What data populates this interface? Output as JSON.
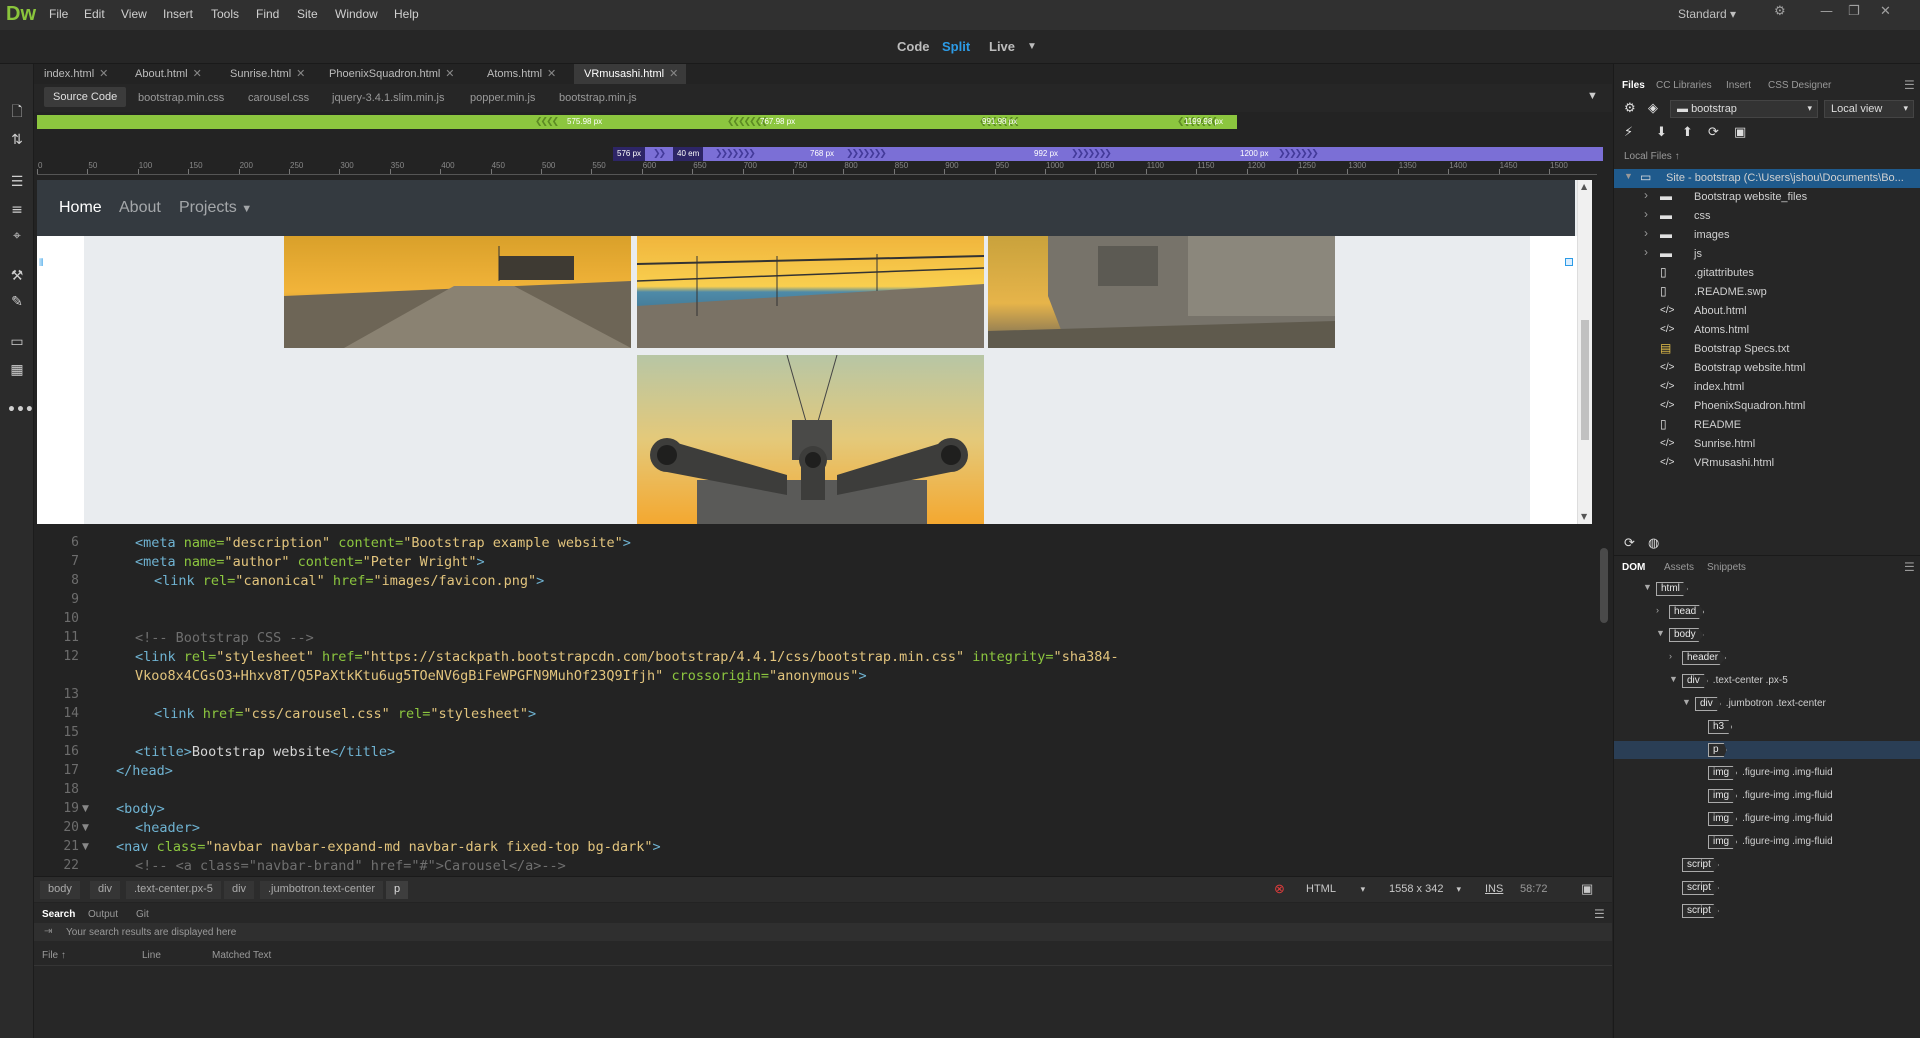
{
  "app": {
    "logo": "Dw",
    "menu": [
      "File",
      "Edit",
      "View",
      "Insert",
      "Tools",
      "Find",
      "Site",
      "Window",
      "Help"
    ],
    "workspace": "Standard"
  },
  "view_switch": {
    "code": "Code",
    "split": "Split",
    "live": "Live"
  },
  "doc_tabs": [
    "index.html",
    "About.html",
    "Sunrise.html",
    "PhoenixSquadron.html",
    "Atoms.html",
    "VRmusashi.html"
  ],
  "related_files": [
    "Source Code",
    "bootstrap.min.css",
    "carousel.css",
    "jquery-3.4.1.slim.min.js",
    "popper.min.js",
    "bootstrap.min.js"
  ],
  "media_queries": {
    "green": [
      "575.98 px",
      "767.98 px",
      "991.98 px",
      "1199.98 px"
    ],
    "purple": [
      "576 px",
      "40 em",
      "768 px",
      "992 px",
      "1200 px"
    ]
  },
  "ruler_ticks": [
    "0",
    "50",
    "100",
    "150",
    "200",
    "250",
    "300",
    "350",
    "400",
    "450",
    "500",
    "550",
    "600",
    "650",
    "700",
    "750",
    "800",
    "850",
    "900",
    "950",
    "1000",
    "1050",
    "1100",
    "1150",
    "1200",
    "1250",
    "1300",
    "1350",
    "1400",
    "1450",
    "1500"
  ],
  "live_view": {
    "nav": {
      "home": "Home",
      "about": "About",
      "projects": "Projects"
    }
  },
  "code_lines": [
    {
      "n": "6"
    },
    {
      "n": "7"
    },
    {
      "n": "8"
    },
    {
      "n": "9"
    },
    {
      "n": "10"
    },
    {
      "n": "11"
    },
    {
      "n": "12"
    },
    {
      "n": "13"
    },
    {
      "n": "14"
    },
    {
      "n": "15"
    },
    {
      "n": "16"
    },
    {
      "n": "17"
    },
    {
      "n": "18"
    },
    {
      "n": "19"
    },
    {
      "n": "20"
    },
    {
      "n": "21"
    },
    {
      "n": "22"
    }
  ],
  "code": {
    "l6_a": "description",
    "l6_b": "Bootstrap example website",
    "l7_a": "author",
    "l7_b": "Peter Wright",
    "l8_a": "canonical",
    "l8_b": "images/favicon.png",
    "l11": "<!-- Bootstrap CSS -->",
    "l12_a": "stylesheet",
    "l12_b": "https://stackpath.bootstrapcdn.com/bootstrap/4.4.1/css/bootstrap.min.css",
    "l12_c": "sha384-",
    "l12_d": "Vkoo8x4CGsO3+Hhxv8T/Q5PaXtkKtu6ug5TOeNV6gBiFeWPGFN9MuhOf23Q9Ifjh",
    "l12_e": "anonymous",
    "l14_a": "css/carousel.css",
    "l14_b": "stylesheet",
    "l16": "Bootstrap website",
    "l21": "navbar navbar-expand-md navbar-dark fixed-top bg-dark",
    "l22": "<!-- <a class=\"navbar-brand\" href=\"#\">Carousel</a>-->"
  },
  "status": {
    "breadcrumbs": [
      "body",
      "div",
      ".text-center.px-5",
      "div",
      ".jumbotron.text-center",
      "p"
    ],
    "language": "HTML",
    "size": "1558 x 342",
    "mode": "INS",
    "position": "58:72"
  },
  "search_panel": {
    "tabs": [
      "Search",
      "Output",
      "Git"
    ],
    "message": "Your search results are displayed here",
    "columns": [
      "File",
      "Line",
      "Matched Text"
    ]
  },
  "files_panel": {
    "tabs": [
      "Files",
      "CC Libraries",
      "Insert",
      "CSS Designer"
    ],
    "site": "bootstrap",
    "view": "Local view",
    "local_files_label": "Local Files",
    "site_root": "Site - bootstrap (C:\\Users\\jshou\\Documents\\Bo...",
    "items": [
      {
        "name": "Bootstrap website_files",
        "type": "folder"
      },
      {
        "name": "css",
        "type": "folder"
      },
      {
        "name": "images",
        "type": "folder"
      },
      {
        "name": "js",
        "type": "folder"
      },
      {
        "name": ".gitattributes",
        "type": "file"
      },
      {
        "name": ".README.swp",
        "type": "file"
      },
      {
        "name": "About.html",
        "type": "code"
      },
      {
        "name": "Atoms.html",
        "type": "code"
      },
      {
        "name": "Bootstrap Specs.txt",
        "type": "text"
      },
      {
        "name": "Bootstrap website.html",
        "type": "code"
      },
      {
        "name": "index.html",
        "type": "code"
      },
      {
        "name": "PhoenixSquadron.html",
        "type": "code"
      },
      {
        "name": "README",
        "type": "file"
      },
      {
        "name": "Sunrise.html",
        "type": "code"
      },
      {
        "name": "VRmusashi.html",
        "type": "code"
      }
    ]
  },
  "dom_panel": {
    "tabs": [
      "DOM",
      "Assets",
      "Snippets"
    ],
    "nodes": [
      {
        "tag": "html",
        "cls": ""
      },
      {
        "tag": "head",
        "cls": ""
      },
      {
        "tag": "body",
        "cls": ""
      },
      {
        "tag": "header",
        "cls": ""
      },
      {
        "tag": "div",
        "cls": ".text-center .px-5"
      },
      {
        "tag": "div",
        "cls": ".jumbotron .text-center"
      },
      {
        "tag": "h3",
        "cls": ""
      },
      {
        "tag": "p",
        "cls": ""
      },
      {
        "tag": "img",
        "cls": ".figure-img .img-fluid"
      },
      {
        "tag": "img",
        "cls": ".figure-img .img-fluid"
      },
      {
        "tag": "img",
        "cls": ".figure-img .img-fluid"
      },
      {
        "tag": "img",
        "cls": ".figure-img .img-fluid"
      },
      {
        "tag": "script",
        "cls": ""
      },
      {
        "tag": "script",
        "cls": ""
      },
      {
        "tag": "script",
        "cls": ""
      }
    ]
  },
  "colors": {
    "accent_green": "#8cc63f",
    "accent_purple": "#7b6fd6",
    "split_blue": "#2c9be6"
  }
}
